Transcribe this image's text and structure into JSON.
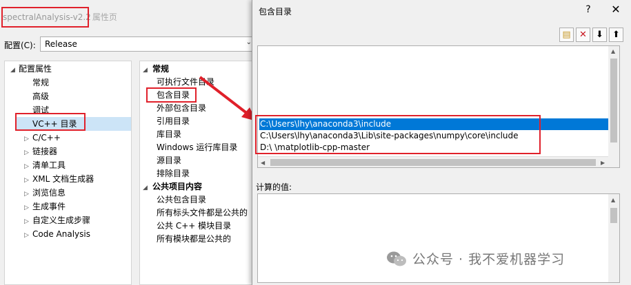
{
  "window": {
    "project_title": "spectralAnalysis-v2.2",
    "title_suffix": "属性页",
    "config_label": "配置(C):",
    "config_value": "Release"
  },
  "tree": {
    "root": "配置属性",
    "items": [
      {
        "label": "常规",
        "expandable": false
      },
      {
        "label": "高级",
        "expandable": false
      },
      {
        "label": "调试",
        "expandable": false
      },
      {
        "label": "VC++ 目录",
        "expandable": false,
        "selected": true
      },
      {
        "label": "C/C++",
        "expandable": true
      },
      {
        "label": "链接器",
        "expandable": true
      },
      {
        "label": "清单工具",
        "expandable": true
      },
      {
        "label": "XML 文档生成器",
        "expandable": true
      },
      {
        "label": "浏览信息",
        "expandable": true
      },
      {
        "label": "生成事件",
        "expandable": true
      },
      {
        "label": "自定义生成步骤",
        "expandable": true
      },
      {
        "label": "Code Analysis",
        "expandable": true
      }
    ]
  },
  "properties": {
    "general_header": "常规",
    "general_items": [
      "可执行文件目录",
      "包含目录",
      "外部包含目录",
      "引用目录",
      "库目录",
      "Windows 运行库目录",
      "源目录",
      "排除目录"
    ],
    "public_header": "公共项目内容",
    "public_items": [
      "公共包含目录",
      "所有标头文件都是公共的",
      "公共 C++ 模块目录",
      "所有模块都是公共的"
    ]
  },
  "dialog": {
    "title": "包含目录",
    "help_label": "?",
    "close_label": "✕",
    "toolbar": {
      "new_line": "▤",
      "delete": "✕",
      "move_down": "⬇",
      "move_up": "⬆"
    },
    "directories": [
      "C:\\Users\\lhy\\anaconda3\\include",
      "C:\\Users\\lhy\\anaconda3\\Lib\\site-packages\\numpy\\core\\include",
      "D:\\                                        \\matplotlib-cpp-master"
    ],
    "evaluated_label": "计算的值:"
  },
  "watermark": "公众号 · 我不爱机器学习",
  "colors": {
    "highlight_red": "#e0202a",
    "selection_blue": "#0078d7",
    "tree_selection": "#cce4f7"
  }
}
